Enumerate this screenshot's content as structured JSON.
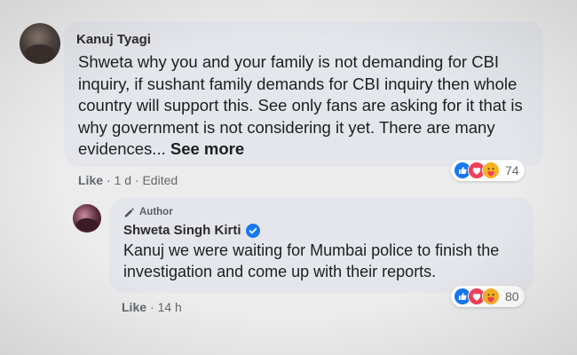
{
  "comment": {
    "author": "Kanuj Tyagi",
    "text": "Shweta why you and your family is not demanding for CBI inquiry, if sushant family demands for CBI inquiry then whole country will support this. See only fans are asking for it that is why government is not considering it yet. There are many evidences...",
    "see_more": "See more",
    "reaction_count": "74",
    "reactions": [
      "like-icon",
      "love-icon",
      "care-icon"
    ],
    "like_label": "Like",
    "meta": "· 1 d · Edited"
  },
  "reply": {
    "badge": "Author",
    "author": "Shweta Singh Kirti",
    "text": "Kanuj we were waiting for Mumbai police to finish the investigation and come up with their reports.",
    "reaction_count": "80",
    "reactions": [
      "like-icon",
      "love-icon",
      "care-icon"
    ],
    "like_label": "Like",
    "meta": "· 14 h"
  },
  "colors": {
    "bubble": "#e4e6eb",
    "like_blue": "#1877f2",
    "love_red": "#f33e58",
    "care_yellow": "#f7b125",
    "verified_blue": "#1877f2"
  }
}
